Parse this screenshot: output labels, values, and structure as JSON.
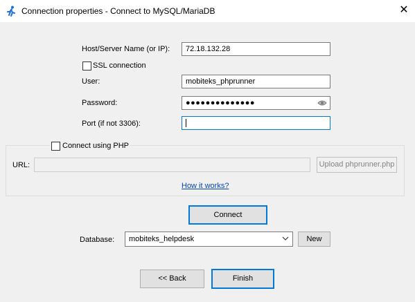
{
  "window": {
    "title": "Connection properties - Connect to MySQL/MariaDB",
    "close_glyph": "✕"
  },
  "form": {
    "host_label": "Host/Server Name  (or IP):",
    "host_value": "72.18.132.28",
    "ssl_label": "SSL connection",
    "ssl_checked": false,
    "user_label": "User:",
    "user_value": "mobiteks_phprunner",
    "password_label": "Password:",
    "password_value": "●●●●●●●●●●●●●●",
    "port_label": "Port (if not 3306):",
    "port_value": ""
  },
  "php": {
    "checkbox_label": "Connect using PHP",
    "checkbox_checked": false,
    "url_label": "URL:",
    "url_value": "",
    "upload_label": "Upload phprunner.php",
    "how_link": "How it works?"
  },
  "connect_label": "Connect",
  "database": {
    "label": "Database:",
    "value": "mobiteks_helpdesk",
    "new_label": "New"
  },
  "footer": {
    "back_label": "<< Back",
    "finish_label": "Finish"
  },
  "icons": {
    "app": "runner-icon",
    "password_toggle": "eye-icon",
    "dropdown": "chevron-down-icon"
  },
  "colors": {
    "accent": "#0078d7",
    "link": "#0645ad",
    "app_icon": "#1e6fd9"
  }
}
